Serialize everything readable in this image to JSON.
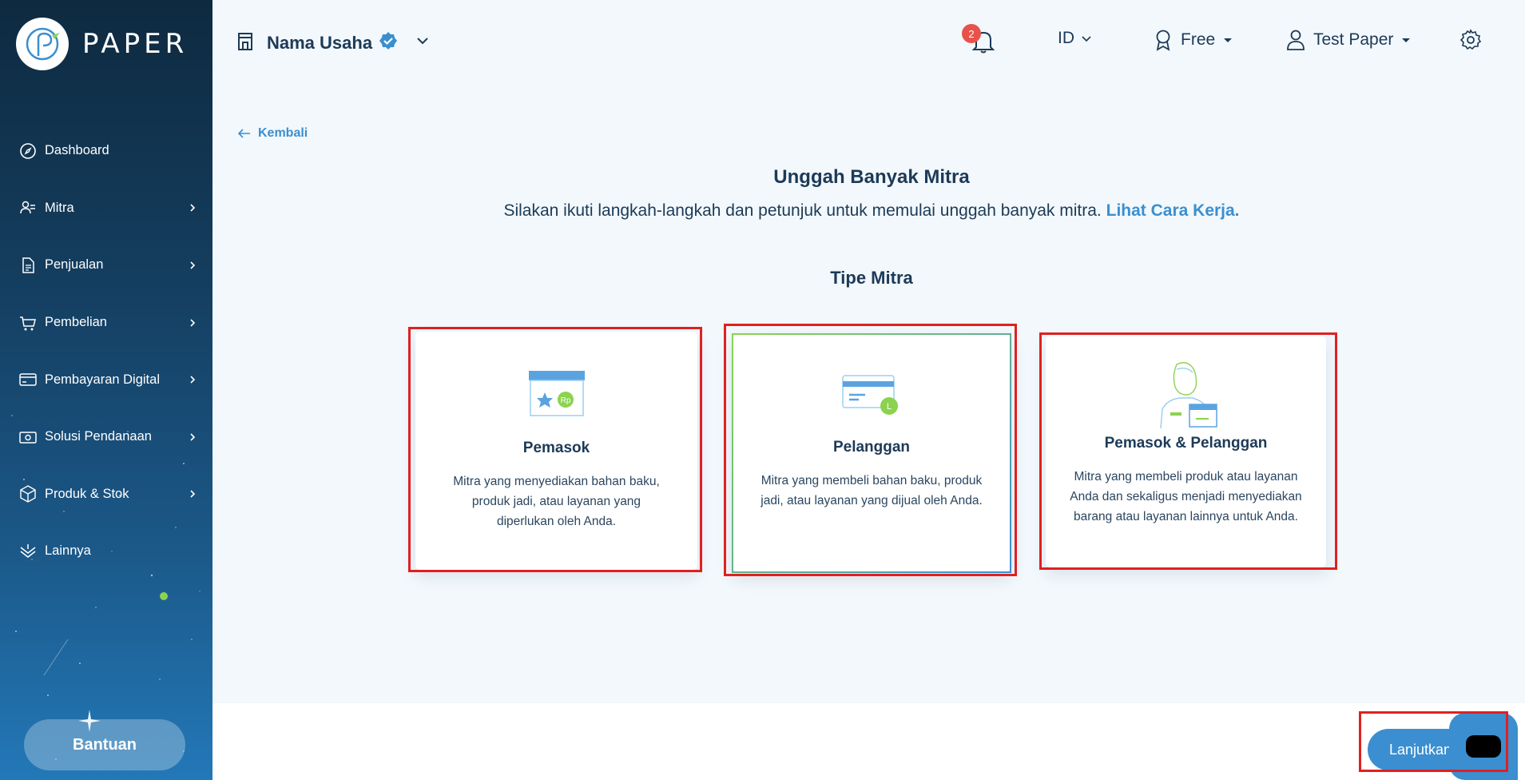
{
  "app": {
    "logo_text": "PAPER"
  },
  "sidebar": {
    "items": [
      {
        "label": "Dashboard",
        "icon": "compass-icon",
        "has_chevron": false
      },
      {
        "label": "Mitra",
        "icon": "users-icon",
        "has_chevron": true
      },
      {
        "label": "Penjualan",
        "icon": "document-icon",
        "has_chevron": true
      },
      {
        "label": "Pembelian",
        "icon": "cart-icon",
        "has_chevron": true
      },
      {
        "label": "Pembayaran Digital",
        "icon": "card-icon",
        "has_chevron": true,
        "new_dot": true
      },
      {
        "label": "Solusi Pendanaan",
        "icon": "cash-icon",
        "has_chevron": true
      },
      {
        "label": "Produk & Stok",
        "icon": "box-icon",
        "has_chevron": true
      },
      {
        "label": "Lainnya",
        "icon": "layers-icon",
        "has_chevron": false
      }
    ],
    "help_label": "Bantuan"
  },
  "header": {
    "business_name": "Nama Usaha",
    "notifications_count": "2",
    "language": "ID",
    "plan": "Free",
    "user_name": "Test Paper"
  },
  "main": {
    "back_label": "Kembali",
    "title": "Unggah Banyak Mitra",
    "subtitle": "Silakan ikuti langkah-langkah dan petunjuk untuk memulai unggah banyak mitra.",
    "subtitle_link": "Lihat Cara Kerja.",
    "section_title": "Tipe Mitra",
    "cards": [
      {
        "title": "Pemasok",
        "desc": "Mitra yang menyediakan bahan baku, produk jadi, atau layanan yang diperlukan oleh Anda.",
        "icon": "supplier-store-icon",
        "selected": false
      },
      {
        "title": "Pelanggan",
        "desc": "Mitra yang membeli bahan baku, produk jadi, atau layanan yang dijual oleh Anda.",
        "icon": "customer-card-icon",
        "selected": true
      },
      {
        "title": "Pemasok & Pelanggan",
        "desc": "Mitra yang membeli produk atau layanan Anda dan sekaligus menjadi menyediakan barang atau layanan lainnya untuk Anda.",
        "icon": "supplier-customer-icon",
        "selected": false
      }
    ]
  },
  "footer": {
    "next_label": "Lanjutkan"
  },
  "colors": {
    "accent": "#3b8fd0",
    "green": "#8bd34f",
    "highlight": "#e02020",
    "text": "#1d3a57"
  }
}
